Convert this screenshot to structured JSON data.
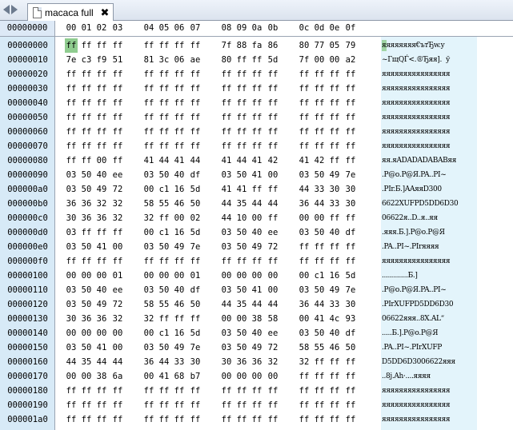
{
  "tab": {
    "title": "macaca full",
    "close_symbol": "✖"
  },
  "header": {
    "offset_label": "00000000",
    "columns": [
      "00",
      "01",
      "02",
      "03",
      "04",
      "05",
      "06",
      "07",
      "08",
      "09",
      "0a",
      "0b",
      "0c",
      "0d",
      "0e",
      "0f"
    ]
  },
  "selection": {
    "row": 0,
    "col": 0
  },
  "rows": [
    {
      "offset": "00000000",
      "bytes": [
        "ff",
        "ff",
        "ff",
        "ff",
        "ff",
        "ff",
        "ff",
        "ff",
        "7f",
        "88",
        "fa",
        "86",
        "80",
        "77",
        "05",
        "79"
      ],
      "text": "яяяяяяяя€ътЂw.y"
    },
    {
      "offset": "00000010",
      "bytes": [
        "7e",
        "c3",
        "f9",
        "51",
        "81",
        "3c",
        "06",
        "ae",
        "80",
        "ff",
        "ff",
        "5d",
        "7f",
        "00",
        "00",
        "a2"
      ],
      "text": "~ГщQЃ<.®Ђяя].  ў"
    },
    {
      "offset": "00000020",
      "bytes": [
        "ff",
        "ff",
        "ff",
        "ff",
        "ff",
        "ff",
        "ff",
        "ff",
        "ff",
        "ff",
        "ff",
        "ff",
        "ff",
        "ff",
        "ff",
        "ff"
      ],
      "text": "яяяяяяяяяяяяяяяя"
    },
    {
      "offset": "00000030",
      "bytes": [
        "ff",
        "ff",
        "ff",
        "ff",
        "ff",
        "ff",
        "ff",
        "ff",
        "ff",
        "ff",
        "ff",
        "ff",
        "ff",
        "ff",
        "ff",
        "ff"
      ],
      "text": "яяяяяяяяяяяяяяяя"
    },
    {
      "offset": "00000040",
      "bytes": [
        "ff",
        "ff",
        "ff",
        "ff",
        "ff",
        "ff",
        "ff",
        "ff",
        "ff",
        "ff",
        "ff",
        "ff",
        "ff",
        "ff",
        "ff",
        "ff"
      ],
      "text": "яяяяяяяяяяяяяяяя"
    },
    {
      "offset": "00000050",
      "bytes": [
        "ff",
        "ff",
        "ff",
        "ff",
        "ff",
        "ff",
        "ff",
        "ff",
        "ff",
        "ff",
        "ff",
        "ff",
        "ff",
        "ff",
        "ff",
        "ff"
      ],
      "text": "яяяяяяяяяяяяяяяя"
    },
    {
      "offset": "00000060",
      "bytes": [
        "ff",
        "ff",
        "ff",
        "ff",
        "ff",
        "ff",
        "ff",
        "ff",
        "ff",
        "ff",
        "ff",
        "ff",
        "ff",
        "ff",
        "ff",
        "ff"
      ],
      "text": "яяяяяяяяяяяяяяяя"
    },
    {
      "offset": "00000070",
      "bytes": [
        "ff",
        "ff",
        "ff",
        "ff",
        "ff",
        "ff",
        "ff",
        "ff",
        "ff",
        "ff",
        "ff",
        "ff",
        "ff",
        "ff",
        "ff",
        "ff"
      ],
      "text": "яяяяяяяяяяяяяяяя"
    },
    {
      "offset": "00000080",
      "bytes": [
        "ff",
        "ff",
        "00",
        "ff",
        "41",
        "44",
        "41",
        "44",
        "41",
        "44",
        "41",
        "42",
        "41",
        "42",
        "ff",
        "ff"
      ],
      "text": "яя.яADADADABABяя"
    },
    {
      "offset": "00000090",
      "bytes": [
        "03",
        "50",
        "40",
        "ee",
        "03",
        "50",
        "40",
        "df",
        "03",
        "50",
        "41",
        "00",
        "03",
        "50",
        "49",
        "7e"
      ],
      "text": ".P@о.P@Я.PA..PI~"
    },
    {
      "offset": "000000a0",
      "bytes": [
        "03",
        "50",
        "49",
        "72",
        "00",
        "c1",
        "16",
        "5d",
        "41",
        "41",
        "ff",
        "ff",
        "44",
        "33",
        "30",
        "30"
      ],
      "text": ".PIr.Б.]AAяяD300"
    },
    {
      "offset": "000000b0",
      "bytes": [
        "36",
        "36",
        "32",
        "32",
        "58",
        "55",
        "46",
        "50",
        "44",
        "35",
        "44",
        "44",
        "36",
        "44",
        "33",
        "30"
      ],
      "text": "6622XUFPD5DD6D30"
    },
    {
      "offset": "000000c0",
      "bytes": [
        "30",
        "36",
        "36",
        "32",
        "32",
        "ff",
        "00",
        "02",
        "44",
        "10",
        "00",
        "ff",
        "00",
        "00",
        "ff",
        "ff"
      ],
      "text": "06622я..D..я..яя"
    },
    {
      "offset": "000000d0",
      "bytes": [
        "03",
        "ff",
        "ff",
        "ff",
        "00",
        "c1",
        "16",
        "5d",
        "03",
        "50",
        "40",
        "ee",
        "03",
        "50",
        "40",
        "df"
      ],
      "text": ".яяя.Б.].P@о.P@Я"
    },
    {
      "offset": "000000e0",
      "bytes": [
        "03",
        "50",
        "41",
        "00",
        "03",
        "50",
        "49",
        "7e",
        "03",
        "50",
        "49",
        "72",
        "ff",
        "ff",
        "ff",
        "ff"
      ],
      "text": ".PA..PI~.PIrяяяя"
    },
    {
      "offset": "000000f0",
      "bytes": [
        "ff",
        "ff",
        "ff",
        "ff",
        "ff",
        "ff",
        "ff",
        "ff",
        "ff",
        "ff",
        "ff",
        "ff",
        "ff",
        "ff",
        "ff",
        "ff"
      ],
      "text": "яяяяяяяяяяяяяяяя"
    },
    {
      "offset": "00000100",
      "bytes": [
        "00",
        "00",
        "00",
        "01",
        "00",
        "00",
        "00",
        "01",
        "00",
        "00",
        "00",
        "00",
        "00",
        "c1",
        "16",
        "5d"
      ],
      "text": ".............Б.]"
    },
    {
      "offset": "00000110",
      "bytes": [
        "03",
        "50",
        "40",
        "ee",
        "03",
        "50",
        "40",
        "df",
        "03",
        "50",
        "41",
        "00",
        "03",
        "50",
        "49",
        "7e"
      ],
      "text": ".P@о.P@Я.PA..PI~"
    },
    {
      "offset": "00000120",
      "bytes": [
        "03",
        "50",
        "49",
        "72",
        "58",
        "55",
        "46",
        "50",
        "44",
        "35",
        "44",
        "44",
        "36",
        "44",
        "33",
        "30"
      ],
      "text": ".PIrXUFPD5DD6D30"
    },
    {
      "offset": "00000130",
      "bytes": [
        "30",
        "36",
        "36",
        "32",
        "32",
        "ff",
        "ff",
        "ff",
        "00",
        "00",
        "38",
        "58",
        "00",
        "41",
        "4c",
        "93"
      ],
      "text": "06622яяя..8X.AL“"
    },
    {
      "offset": "00000140",
      "bytes": [
        "00",
        "00",
        "00",
        "00",
        "00",
        "c1",
        "16",
        "5d",
        "03",
        "50",
        "40",
        "ee",
        "03",
        "50",
        "40",
        "df"
      ],
      "text": ".....Б.].P@о.P@Я"
    },
    {
      "offset": "00000150",
      "bytes": [
        "03",
        "50",
        "41",
        "00",
        "03",
        "50",
        "49",
        "7e",
        "03",
        "50",
        "49",
        "72",
        "58",
        "55",
        "46",
        "50"
      ],
      "text": ".PA..PI~.PIrXUFP"
    },
    {
      "offset": "00000160",
      "bytes": [
        "44",
        "35",
        "44",
        "44",
        "36",
        "44",
        "33",
        "30",
        "30",
        "36",
        "36",
        "32",
        "32",
        "ff",
        "ff",
        "ff"
      ],
      "text": "D5DD6D3006622яяя"
    },
    {
      "offset": "00000170",
      "bytes": [
        "00",
        "00",
        "38",
        "6a",
        "00",
        "41",
        "68",
        "b7",
        "00",
        "00",
        "00",
        "00",
        "ff",
        "ff",
        "ff",
        "ff"
      ],
      "text": "..8j.Ah·....яяяя"
    },
    {
      "offset": "00000180",
      "bytes": [
        "ff",
        "ff",
        "ff",
        "ff",
        "ff",
        "ff",
        "ff",
        "ff",
        "ff",
        "ff",
        "ff",
        "ff",
        "ff",
        "ff",
        "ff",
        "ff"
      ],
      "text": "яяяяяяяяяяяяяяяя"
    },
    {
      "offset": "00000190",
      "bytes": [
        "ff",
        "ff",
        "ff",
        "ff",
        "ff",
        "ff",
        "ff",
        "ff",
        "ff",
        "ff",
        "ff",
        "ff",
        "ff",
        "ff",
        "ff",
        "ff"
      ],
      "text": "яяяяяяяяяяяяяяяя"
    },
    {
      "offset": "000001a0",
      "bytes": [
        "ff",
        "ff",
        "ff",
        "ff",
        "ff",
        "ff",
        "ff",
        "ff",
        "ff",
        "ff",
        "ff",
        "ff",
        "ff",
        "ff",
        "ff",
        "ff"
      ],
      "text": "яяяяяяяяяяяяяяяя"
    }
  ]
}
